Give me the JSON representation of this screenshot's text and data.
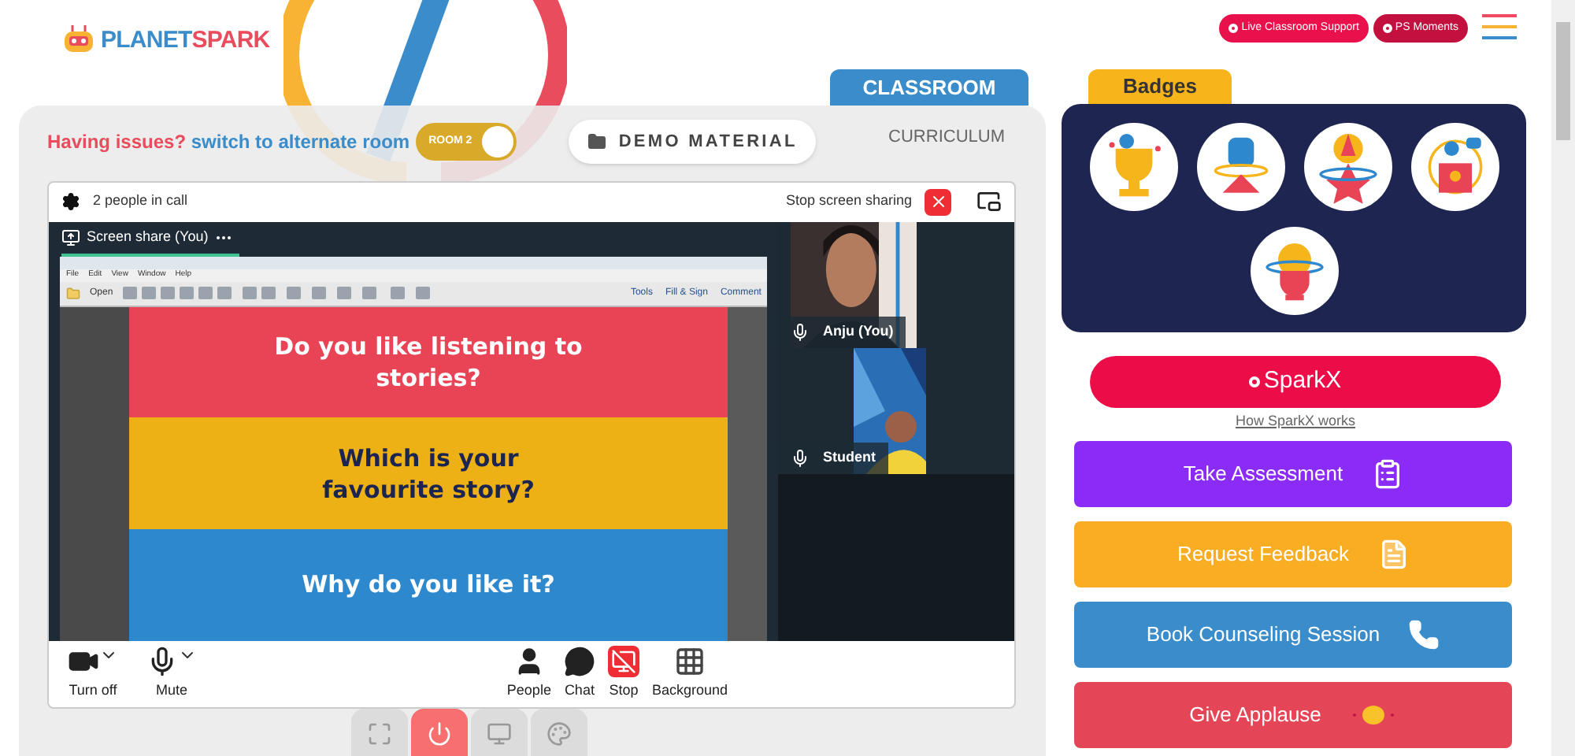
{
  "logo": {
    "part_a": "PLANET",
    "part_b": "SPARK"
  },
  "header_buttons": [
    {
      "label": "Live Classroom Support"
    },
    {
      "label": "PS Moments"
    }
  ],
  "tabs": [
    {
      "label": "CLASSROOM",
      "selected": true
    },
    {
      "label": "CURRICULUM",
      "selected": false
    }
  ],
  "issue": {
    "warning": "Having issues?",
    "link": "switch to alternate room"
  },
  "room_toggle": {
    "label": "ROOM 2",
    "on": true
  },
  "demo_button": {
    "label": "DEMO MATERIAL"
  },
  "call": {
    "people": "2 people in call",
    "stop_sharing": "Stop screen sharing",
    "share_tab": {
      "label": "Screen share (You)"
    },
    "pdf": {
      "menu": [
        "File",
        "Edit",
        "View",
        "Window",
        "Help"
      ],
      "open": "Open",
      "tools": [
        "Tools",
        "Fill & Sign",
        "Comment"
      ]
    },
    "slide": [
      {
        "text": "Do you like listening to stories?",
        "color": "#e84456",
        "kind": "light"
      },
      {
        "text": "Which is your favourite story?",
        "color": "#eeb115",
        "kind": "dark"
      },
      {
        "text": "Why do you like it?",
        "color": "#2d88cd",
        "kind": "light"
      }
    ],
    "participants": [
      {
        "name": "Anju (You)",
        "kind": "teacher"
      },
      {
        "name": "Student",
        "kind": "student"
      }
    ],
    "controls": [
      {
        "label": "Turn off",
        "kind": "camera"
      },
      {
        "label": "Mute",
        "kind": "mic"
      },
      {
        "label": "People",
        "kind": "people"
      },
      {
        "label": "Chat",
        "kind": "chat"
      },
      {
        "label": "Stop",
        "kind": "stop"
      },
      {
        "label": "Background",
        "kind": "background"
      }
    ]
  },
  "bottom_tools": [
    {
      "kind": "fullscreen"
    },
    {
      "kind": "power"
    },
    {
      "kind": "screen"
    },
    {
      "kind": "palette"
    }
  ],
  "badges": {
    "title": "Badges",
    "items": [
      {
        "kind": "trophy"
      },
      {
        "kind": "fist"
      },
      {
        "kind": "star"
      },
      {
        "kind": "podium"
      },
      {
        "kind": "brain"
      }
    ]
  },
  "sparkx": {
    "label": "SparkX",
    "link": "How SparkX works"
  },
  "actions": [
    {
      "label": "Take Assessment",
      "color": "#8a2cf6",
      "kind": "clipboard"
    },
    {
      "label": "Request Feedback",
      "color": "#f9ad23",
      "kind": "document"
    },
    {
      "label": "Book Counseling Session",
      "color": "#3a8dca",
      "kind": "phone"
    },
    {
      "label": "Give Applause",
      "color": "#e54657",
      "kind": "clap"
    }
  ]
}
